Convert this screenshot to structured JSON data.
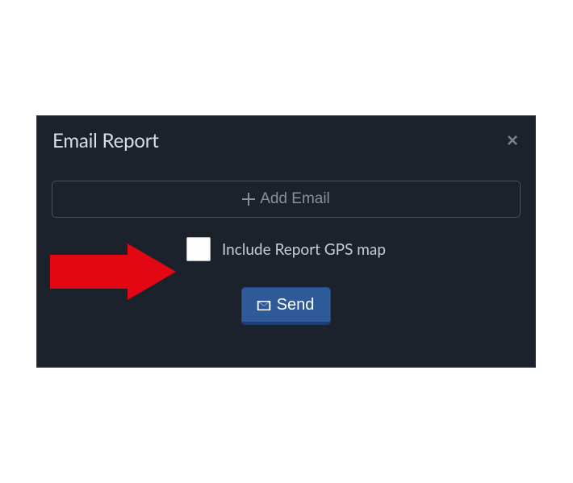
{
  "dialog": {
    "title": "Email Report",
    "close_aria": "Close",
    "add_email_label": "Add Email",
    "include_gps_label": "Include Report GPS map",
    "include_gps_checked": false,
    "send_label": "Send"
  },
  "annotation": {
    "arrow_color": "#e30613",
    "arrow_name": "red-arrow-pointing-to-checkbox"
  }
}
